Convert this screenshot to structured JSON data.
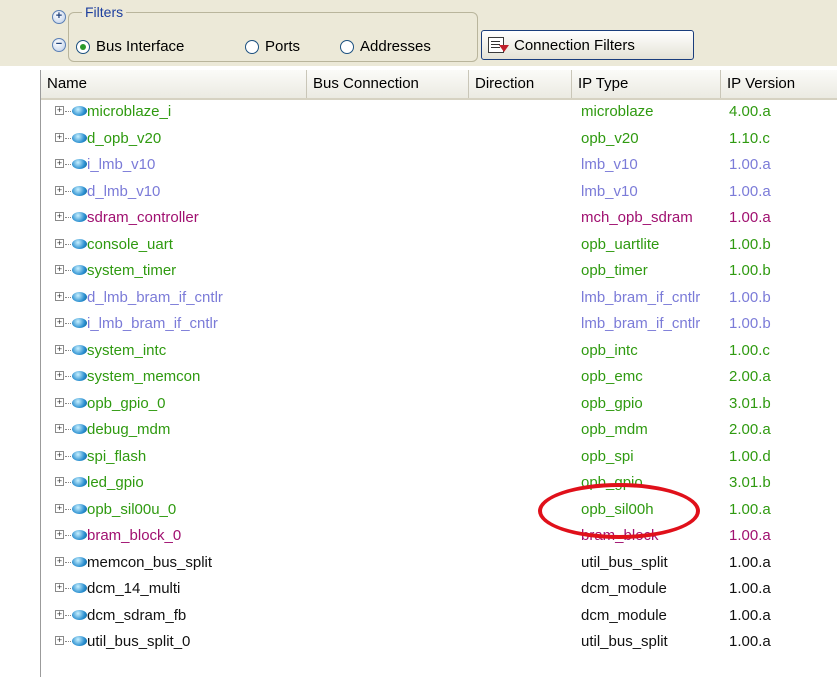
{
  "filters": {
    "legend": "Filters",
    "options": [
      {
        "label": "Bus Interface",
        "selected": true
      },
      {
        "label": "Ports",
        "selected": false
      },
      {
        "label": "Addresses",
        "selected": false
      }
    ],
    "connection_filters_label": "Connection Filters",
    "expand_icon": "plus-circle-icon",
    "collapse_icon": "minus-circle-icon"
  },
  "table": {
    "columns": [
      "Name",
      "Bus Connection",
      "Direction",
      "IP Type",
      "IP Version"
    ],
    "rows": [
      {
        "name": "microblaze_i",
        "ip_type": "microblaze",
        "ip_version": "4.00.a",
        "color": "green"
      },
      {
        "name": "d_opb_v20",
        "ip_type": "opb_v20",
        "ip_version": "1.10.c",
        "color": "green"
      },
      {
        "name": "i_lmb_v10",
        "ip_type": "lmb_v10",
        "ip_version": "1.00.a",
        "color": "blue"
      },
      {
        "name": "d_lmb_v10",
        "ip_type": "lmb_v10",
        "ip_version": "1.00.a",
        "color": "blue"
      },
      {
        "name": "sdram_controller",
        "ip_type": "mch_opb_sdram",
        "ip_version": "1.00.a",
        "color": "magenta"
      },
      {
        "name": "console_uart",
        "ip_type": "opb_uartlite",
        "ip_version": "1.00.b",
        "color": "green"
      },
      {
        "name": "system_timer",
        "ip_type": "opb_timer",
        "ip_version": "1.00.b",
        "color": "green"
      },
      {
        "name": "d_lmb_bram_if_cntlr",
        "ip_type": "lmb_bram_if_cntlr",
        "ip_version": "1.00.b",
        "color": "blue"
      },
      {
        "name": "i_lmb_bram_if_cntlr",
        "ip_type": "lmb_bram_if_cntlr",
        "ip_version": "1.00.b",
        "color": "blue"
      },
      {
        "name": "system_intc",
        "ip_type": "opb_intc",
        "ip_version": "1.00.c",
        "color": "green"
      },
      {
        "name": "system_memcon",
        "ip_type": "opb_emc",
        "ip_version": "2.00.a",
        "color": "green"
      },
      {
        "name": "opb_gpio_0",
        "ip_type": "opb_gpio",
        "ip_version": "3.01.b",
        "color": "green"
      },
      {
        "name": "debug_mdm",
        "ip_type": "opb_mdm",
        "ip_version": "2.00.a",
        "color": "green"
      },
      {
        "name": "spi_flash",
        "ip_type": "opb_spi",
        "ip_version": "1.00.d",
        "color": "green"
      },
      {
        "name": "led_gpio",
        "ip_type": "opb_gpio",
        "ip_version": "3.01.b",
        "color": "green"
      },
      {
        "name": "opb_sil00u_0",
        "ip_type": "opb_sil00h",
        "ip_version": "1.00.a",
        "color": "green"
      },
      {
        "name": "bram_block_0",
        "ip_type": "bram_block",
        "ip_version": "1.00.a",
        "color": "magenta"
      },
      {
        "name": "memcon_bus_split",
        "ip_type": "util_bus_split",
        "ip_version": "1.00.a",
        "color": "black"
      },
      {
        "name": "dcm_14_multi",
        "ip_type": "dcm_module",
        "ip_version": "1.00.a",
        "color": "black"
      },
      {
        "name": "dcm_sdram_fb",
        "ip_type": "dcm_module",
        "ip_version": "1.00.a",
        "color": "black"
      },
      {
        "name": "util_bus_split_0",
        "ip_type": "util_bus_split",
        "ip_version": "1.00.a",
        "color": "black"
      }
    ]
  },
  "colors": {
    "green": "#2f9a10",
    "blue": "#7b7bd8",
    "magenta": "#a01070",
    "annotation": "#e0101a"
  },
  "icons": {
    "row_expander": "plus-box-icon",
    "row_item": "blue-gem-icon",
    "connection_filters": "filter-icon"
  }
}
